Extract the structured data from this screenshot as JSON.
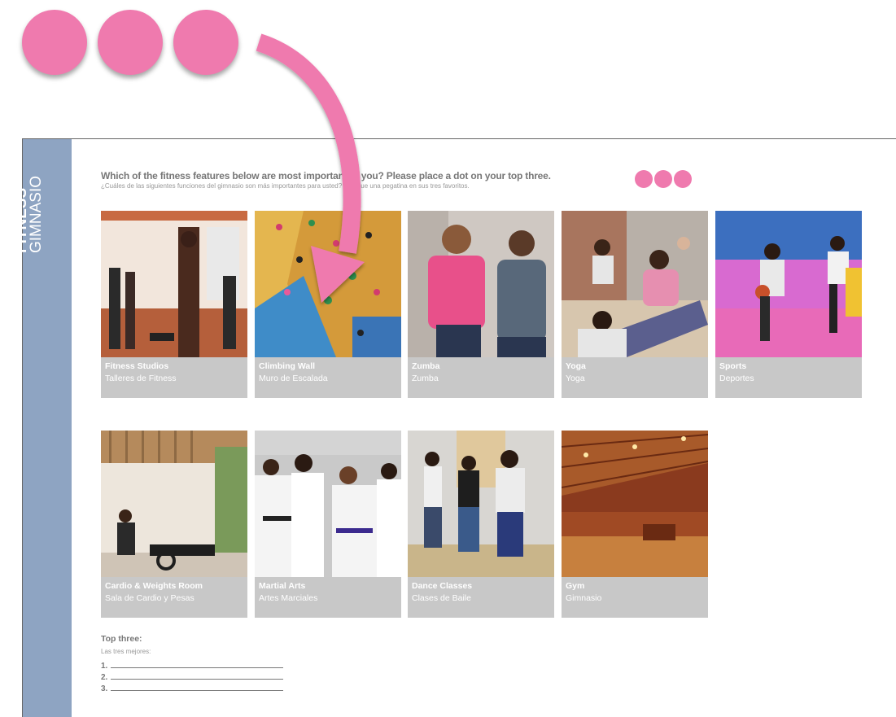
{
  "question": {
    "en": "Which of the fitness features below are most important to you? Please place a dot on your top three.",
    "es": "¿Cuáles de las siguientes funciones del gimnasio son más importantes para usted? Coloque una pegatina en sus tres favoritos."
  },
  "sidebar": {
    "en": "FITNESS",
    "es": "GIMNASIO"
  },
  "features": [
    {
      "en": "Fitness Studios",
      "es": "Talleres de Fitness"
    },
    {
      "en": "Climbing Wall",
      "es": "Muro de Escalada"
    },
    {
      "en": "Zumba",
      "es": "Zumba"
    },
    {
      "en": "Yoga",
      "es": "Yoga"
    },
    {
      "en": "Sports",
      "es": "Deportes"
    },
    {
      "en": "Cardio & Weights Room",
      "es": "Sala de Cardio y Pesas"
    },
    {
      "en": "Martial Arts",
      "es": "Artes Marciales"
    },
    {
      "en": "Dance Classes",
      "es": "Clases de Baile"
    },
    {
      "en": "Gym",
      "es": "Gimnasio"
    }
  ],
  "top_three": {
    "title": "Top three:",
    "subtitle": "Las tres mejores:",
    "items": [
      "1.",
      "2.",
      "3."
    ]
  },
  "colors": {
    "dot": "#ef7aae",
    "sidebar": "#8ea4c2",
    "card": "#c8c8c8"
  },
  "icons": {
    "arrow": "curved-arrow-icon"
  }
}
